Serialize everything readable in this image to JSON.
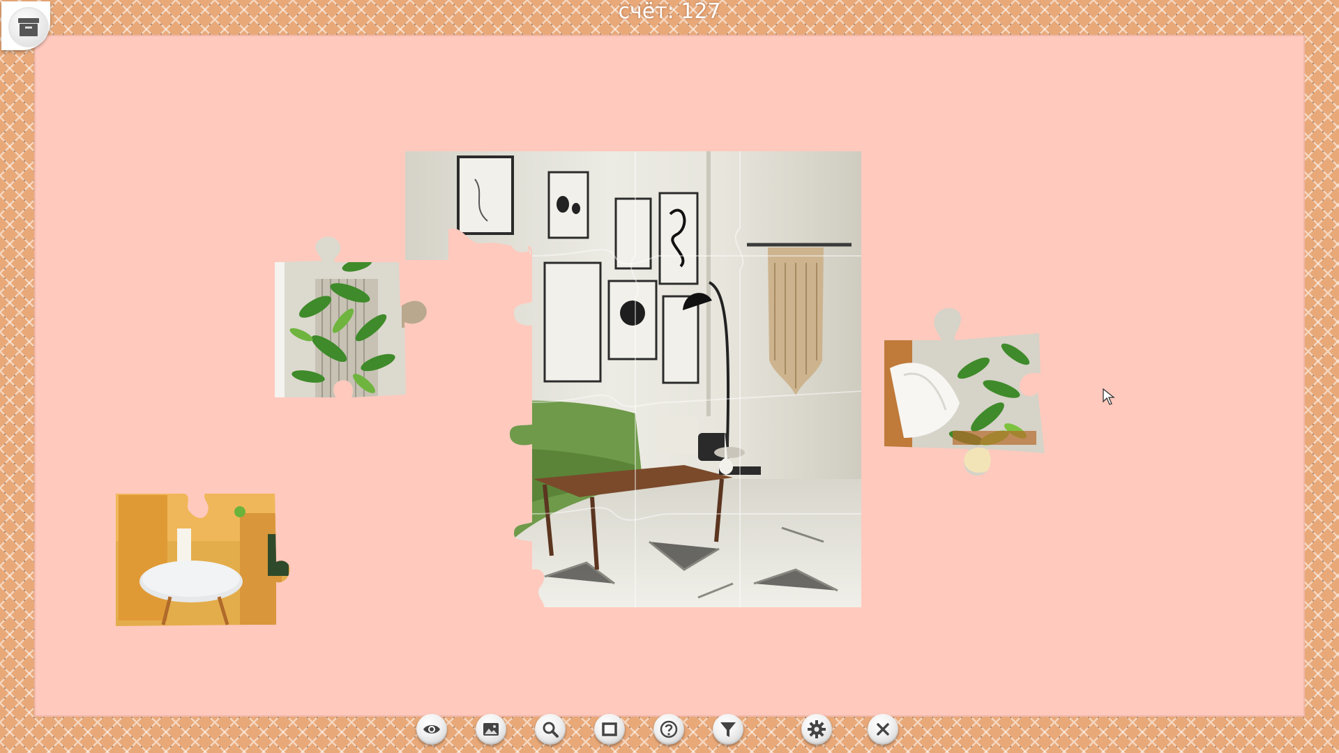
{
  "hud": {
    "score_text": "счёт: 127"
  },
  "toolbar": {
    "buttons": [
      {
        "name": "eye-button",
        "icon": "eye-icon"
      },
      {
        "name": "picture-button",
        "icon": "image-icon"
      },
      {
        "name": "zoom-button",
        "icon": "magnifier-icon"
      },
      {
        "name": "frame-button",
        "icon": "square-icon"
      },
      {
        "name": "help-button",
        "icon": "question-icon"
      },
      {
        "name": "filter-button",
        "icon": "funnel-icon"
      },
      {
        "name": "settings-button",
        "icon": "gear-icon"
      },
      {
        "name": "close-button",
        "icon": "close-icon"
      }
    ]
  },
  "menu": {
    "icon": "box-icon"
  },
  "colors": {
    "board": "#ffc9bd",
    "border": "#e8a878",
    "sofa": "#6f9a4a",
    "wall": "#e3e1d7"
  }
}
